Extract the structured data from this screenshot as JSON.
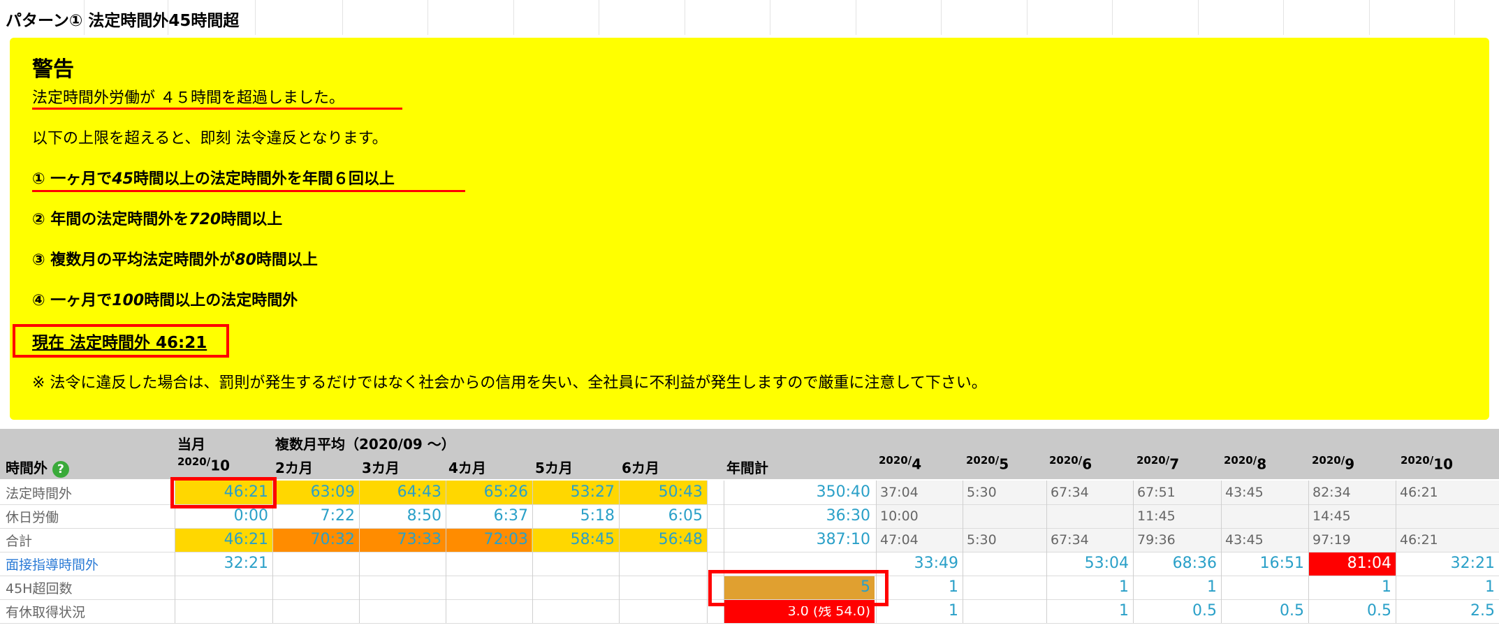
{
  "page_title": "パターン①  法定時間外45時間超",
  "warning": {
    "title": "警告",
    "line1": "法定時間外労働が ４５時間を超過しました。",
    "line2": "以下の上限を超えると、即刻 法令違反となります。",
    "rule1_pre": "① 一ヶ月で",
    "rule1_num": "45",
    "rule1_post": "時間以上の法定時間外を年間６回以上",
    "rule2_pre": "② 年間の法定時間外を",
    "rule2_num": "720",
    "rule2_post": "時間以上",
    "rule3_pre": "③ 複数月の平均法定時間外が",
    "rule3_num": "80",
    "rule3_post": "時間以上",
    "rule4_pre": "④ 一ヶ月で",
    "rule4_num": "100",
    "rule4_post": "時間以上の法定時間外",
    "current": "現在 法定時間外 46:21",
    "note": "※ 法令に違反した場合は、罰則が発生するだけではなく社会からの信用を失い、全社員に不利益が発生しますので厳重に注意して下さい。"
  },
  "table": {
    "group_current": "当月",
    "group_multi": "複数月平均（2020/09 ～）",
    "section_label": "時間外",
    "help_icon": "question-circle-icon",
    "col_current_year": "2020/",
    "col_current_month": "10",
    "multi_cols": [
      "2カ月",
      "3カ月",
      "4カ月",
      "5カ月",
      "6カ月"
    ],
    "annual_label": "年間計",
    "month_cols": [
      {
        "y": "2020/",
        "m": "4"
      },
      {
        "y": "2020/",
        "m": "5"
      },
      {
        "y": "2020/",
        "m": "6"
      },
      {
        "y": "2020/",
        "m": "7"
      },
      {
        "y": "2020/",
        "m": "8"
      },
      {
        "y": "2020/",
        "m": "9"
      },
      {
        "y": "2020/",
        "m": "10"
      }
    ],
    "rows": [
      {
        "label": "法定時間外",
        "current": "46:21",
        "multi": [
          "63:09",
          "64:43",
          "65:26",
          "53:27",
          "50:43"
        ],
        "annual": "350:40",
        "months": [
          "37:04",
          "5:30",
          "67:34",
          "67:51",
          "43:45",
          "82:34",
          "46:21"
        ]
      },
      {
        "label": "休日労働",
        "current": "0:00",
        "multi": [
          "7:22",
          "8:50",
          "6:37",
          "5:18",
          "6:05"
        ],
        "annual": "36:30",
        "months": [
          "10:00",
          "",
          "",
          "11:45",
          "",
          "14:45",
          ""
        ]
      },
      {
        "label": "合計",
        "current": "46:21",
        "multi": [
          "70:32",
          "73:33",
          "72:03",
          "58:45",
          "56:48"
        ],
        "annual": "387:10",
        "months": [
          "47:04",
          "5:30",
          "67:34",
          "79:36",
          "43:45",
          "97:19",
          "46:21"
        ]
      },
      {
        "label": "面接指導時間外",
        "current": "32:21",
        "multi": [
          "",
          "",
          "",
          "",
          ""
        ],
        "annual": "",
        "months": [
          "33:49",
          "",
          "53:04",
          "68:36",
          "16:51",
          "81:04",
          "32:21"
        ]
      },
      {
        "label": "45H超回数",
        "current": "",
        "multi": [
          "",
          "",
          "",
          "",
          ""
        ],
        "annual": "5",
        "months": [
          "1",
          "",
          "1",
          "1",
          "",
          "1",
          "1"
        ]
      },
      {
        "label": "有休取得状況",
        "current": "",
        "multi": [
          "",
          "",
          "",
          "",
          ""
        ],
        "annual": "3.0 (残 54.0)",
        "months": [
          "1",
          "",
          "1",
          "0.5",
          "0.5",
          "0.5",
          "2.5"
        ]
      }
    ]
  },
  "colors": {
    "warning_bg": "#ffff00",
    "highlight_yellow": "#ffd700",
    "highlight_orange": "#ff8c00",
    "alert_red": "#ff0000",
    "count_brown": "#e0a030",
    "value_blue": "#2aa0c8"
  }
}
